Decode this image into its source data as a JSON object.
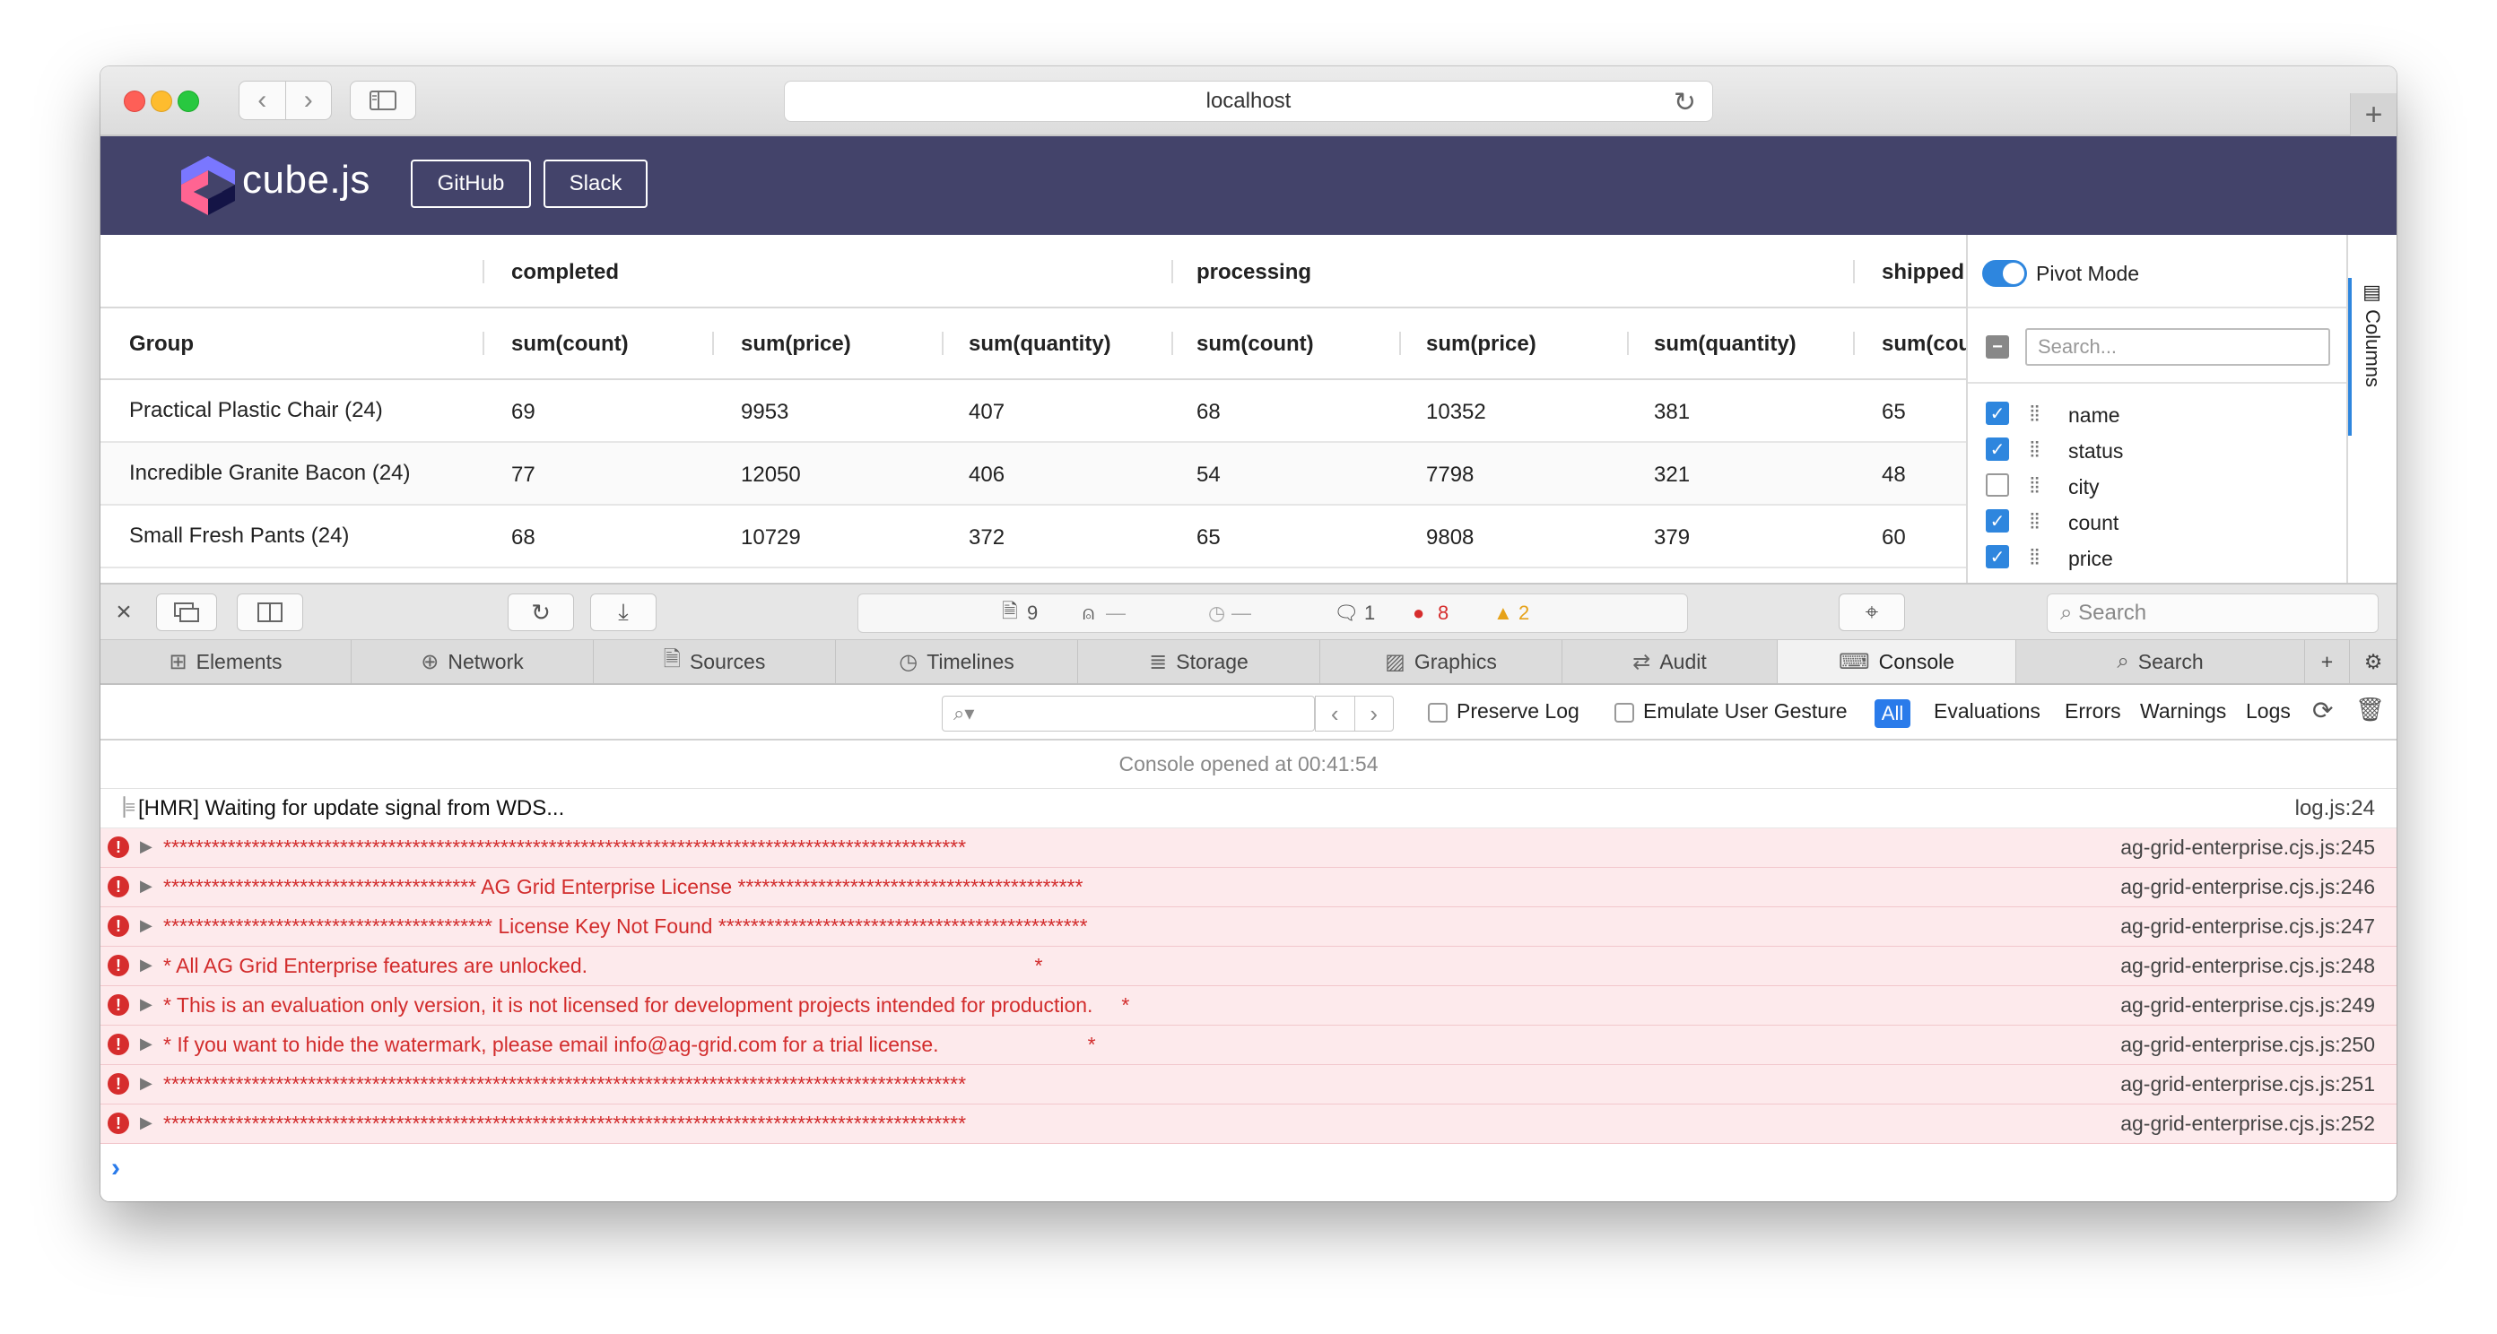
{
  "browser": {
    "url": "localhost"
  },
  "app": {
    "logo": "cube.js",
    "buttons": [
      "GitHub",
      "Slack"
    ]
  },
  "grid": {
    "group_headers": [
      "completed",
      "processing",
      "shipped"
    ],
    "column_headers": [
      "Group",
      "sum(count)",
      "sum(price)",
      "sum(quantity)",
      "sum(count)",
      "sum(price)",
      "sum(quantity)",
      "sum(cou"
    ],
    "rows": [
      [
        "Practical Plastic Chair (24)",
        "69",
        "9953",
        "407",
        "68",
        "10352",
        "381",
        "65"
      ],
      [
        "Incredible Granite Bacon (24)",
        "77",
        "12050",
        "406",
        "54",
        "7798",
        "321",
        "48"
      ],
      [
        "Small Fresh Pants (24)",
        "68",
        "10729",
        "372",
        "65",
        "9808",
        "379",
        "60"
      ]
    ]
  },
  "side_panel": {
    "pivot_mode": "Pivot Mode",
    "search_placeholder": "Search...",
    "columns": [
      {
        "name": "name",
        "checked": true
      },
      {
        "name": "status",
        "checked": true
      },
      {
        "name": "city",
        "checked": false
      },
      {
        "name": "count",
        "checked": true
      },
      {
        "name": "price",
        "checked": true
      }
    ],
    "tab_label": "Columns"
  },
  "devtools": {
    "activity": {
      "resources": "9",
      "network": "—",
      "time": "—",
      "logs": "1",
      "errors": "8",
      "warnings": "2"
    },
    "search_placeholder": "Search",
    "tabs": [
      "Elements",
      "Network",
      "Sources",
      "Timelines",
      "Storage",
      "Graphics",
      "Audit",
      "Console",
      "Search"
    ],
    "active_tab": "Console",
    "filter": {
      "preserve_log": "Preserve Log",
      "emulate_gesture": "Emulate User Gesture",
      "levels": [
        "All",
        "Evaluations",
        "Errors",
        "Warnings",
        "Logs"
      ]
    },
    "console": {
      "opened": "Console opened at 00:41:54",
      "entries": [
        {
          "type": "log",
          "message": "[HMR] Waiting for update signal from WDS...",
          "source": "log.js:24"
        },
        {
          "type": "error",
          "message": "****************************************************************************************************",
          "source": "ag-grid-enterprise.cjs.js:245"
        },
        {
          "type": "error",
          "message": "*************************************** AG Grid Enterprise License *******************************************",
          "source": "ag-grid-enterprise.cjs.js:246"
        },
        {
          "type": "error",
          "message": "***************************************** License Key Not Found **********************************************",
          "source": "ag-grid-enterprise.cjs.js:247"
        },
        {
          "type": "error",
          "message": "* All AG Grid Enterprise features are unlocked.                                                                              *",
          "source": "ag-grid-enterprise.cjs.js:248"
        },
        {
          "type": "error",
          "message": "* This is an evaluation only version, it is not licensed for development projects intended for production.     *",
          "source": "ag-grid-enterprise.cjs.js:249"
        },
        {
          "type": "error",
          "message": "* If you want to hide the watermark, please email info@ag-grid.com for a trial license.                          *",
          "source": "ag-grid-enterprise.cjs.js:250"
        },
        {
          "type": "error",
          "message": "****************************************************************************************************",
          "source": "ag-grid-enterprise.cjs.js:251"
        },
        {
          "type": "error",
          "message": "****************************************************************************************************",
          "source": "ag-grid-enterprise.cjs.js:252"
        }
      ]
    }
  },
  "colors": {
    "header_bg": "#43436a",
    "accent": "#2e86de",
    "error_text": "#d22c2c",
    "error_bg": "#fdeaec"
  }
}
